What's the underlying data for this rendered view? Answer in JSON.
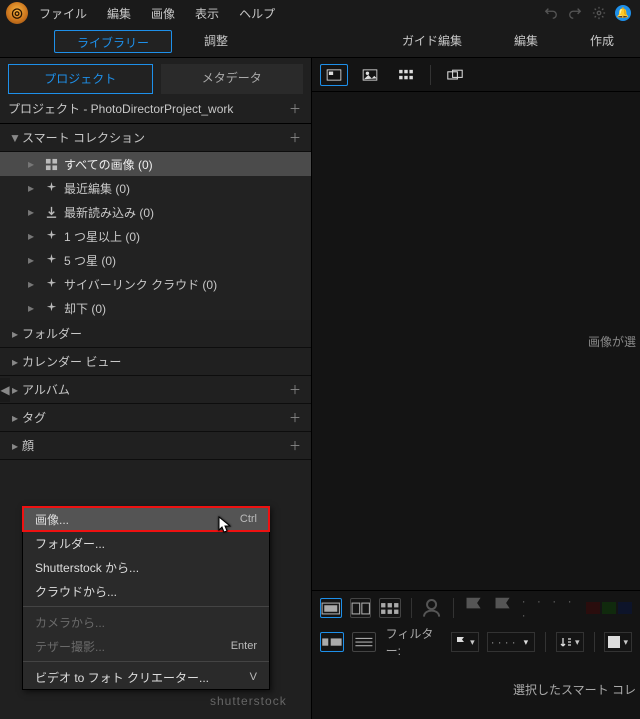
{
  "menubar": {
    "items": [
      "ファイル",
      "編集",
      "画像",
      "表示",
      "ヘルプ"
    ]
  },
  "modtabs": {
    "library": "ライブラリー",
    "adjust": "調整",
    "guided": "ガイド編集",
    "edit": "編集",
    "create": "作成"
  },
  "subtabs": {
    "project": "プロジェクト",
    "metadata": "メタデータ"
  },
  "project_line": "プロジェクト - PhotoDirectorProject_work",
  "sections": {
    "smart": "スマート コレクション",
    "folder": "フォルダー",
    "calendar": "カレンダー ビュー",
    "album": "アルバム",
    "tag": "タグ",
    "face": "顔"
  },
  "smart_items": [
    "すべての画像 (0)",
    "最近編集 (0)",
    "最新読み込み (0)",
    "1 つ星以上 (0)",
    "5 つ星 (0)",
    "サイバーリンク クラウド (0)",
    "却下 (0)"
  ],
  "empty_msg": "画像が選",
  "filter_label": "フィルター:",
  "selected_msg": "選択したスマート コレ",
  "context_menu": {
    "items": [
      {
        "label": "画像...",
        "shortcut": "Ctrl",
        "hot": true
      },
      {
        "label": "フォルダー..."
      },
      {
        "label": "Shutterstock から..."
      },
      {
        "label": "クラウドから..."
      }
    ],
    "group2": [
      {
        "label": "カメラから...",
        "disabled": true
      },
      {
        "label": "テザー撮影...",
        "shortcut": "Enter",
        "disabled": true
      }
    ],
    "group3": [
      {
        "label": "ビデオ to フォト クリエーター...",
        "shortcut": "V"
      }
    ]
  },
  "shutter_text": "shutterstock"
}
